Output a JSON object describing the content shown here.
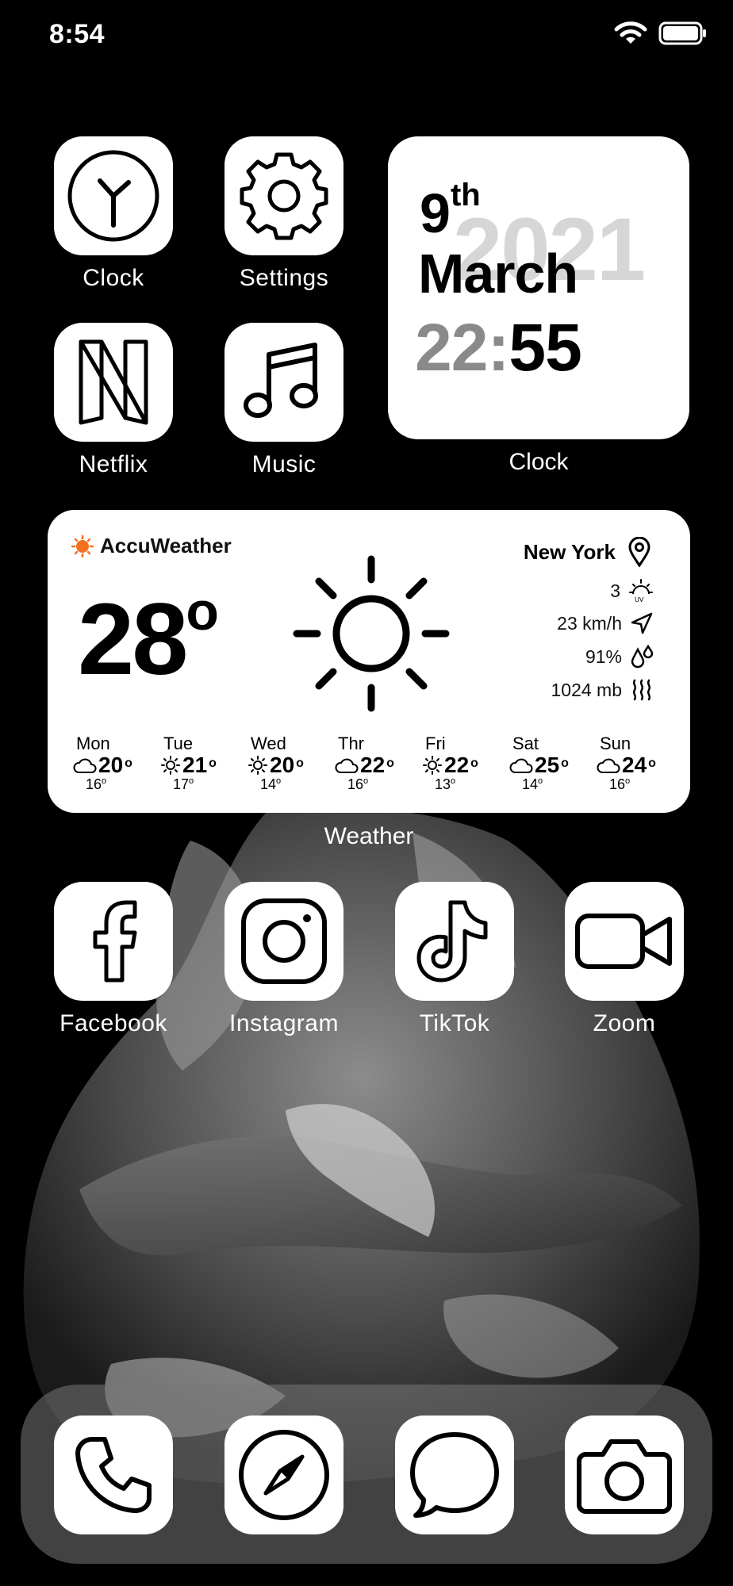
{
  "status_bar": {
    "time": "8:54"
  },
  "apps_top": [
    {
      "label": "Clock",
      "icon": "clock-icon"
    },
    {
      "label": "Settings",
      "icon": "gear-icon"
    },
    {
      "label": "Netflix",
      "icon": "netflix-icon"
    },
    {
      "label": "Music",
      "icon": "music-note-icon"
    }
  ],
  "clock_widget": {
    "day": "9",
    "day_suffix": "th",
    "month": "March",
    "year": "2021",
    "hours": "22",
    "colon": ":",
    "minutes": "55",
    "label": "Clock"
  },
  "weather_widget": {
    "brand": "AccuWeather",
    "city": "New York",
    "current_temp": "28",
    "degree": "o",
    "uv": "3",
    "wind": "23 km/h",
    "humidity": "91%",
    "pressure": "1024 mb",
    "label": "Weather",
    "forecast": [
      {
        "day": "Mon",
        "icon": "cloud-icon",
        "hi": "20",
        "lo": "16"
      },
      {
        "day": "Tue",
        "icon": "sun-icon",
        "hi": "21",
        "lo": "17"
      },
      {
        "day": "Wed",
        "icon": "sun-icon",
        "hi": "20",
        "lo": "14"
      },
      {
        "day": "Thr",
        "icon": "cloud-icon",
        "hi": "22",
        "lo": "16"
      },
      {
        "day": "Fri",
        "icon": "sun-icon",
        "hi": "22",
        "lo": "13"
      },
      {
        "day": "Sat",
        "icon": "cloud-icon",
        "hi": "25",
        "lo": "14"
      },
      {
        "day": "Sun",
        "icon": "cloud-icon",
        "hi": "24",
        "lo": "16"
      }
    ]
  },
  "apps_row2": [
    {
      "label": "Facebook",
      "icon": "facebook-icon"
    },
    {
      "label": "Instagram",
      "icon": "instagram-icon"
    },
    {
      "label": "TikTok",
      "icon": "tiktok-icon"
    },
    {
      "label": "Zoom",
      "icon": "video-camera-icon"
    }
  ],
  "dock": [
    {
      "icon": "phone-icon"
    },
    {
      "icon": "compass-icon"
    },
    {
      "icon": "message-bubble-icon"
    },
    {
      "icon": "camera-icon"
    }
  ],
  "colors": {
    "background": "#000000",
    "tile": "#ffffff",
    "year_gray": "#d6d6d6",
    "hour_gray": "#8a8a8a",
    "accent_orange": "#f37021"
  }
}
